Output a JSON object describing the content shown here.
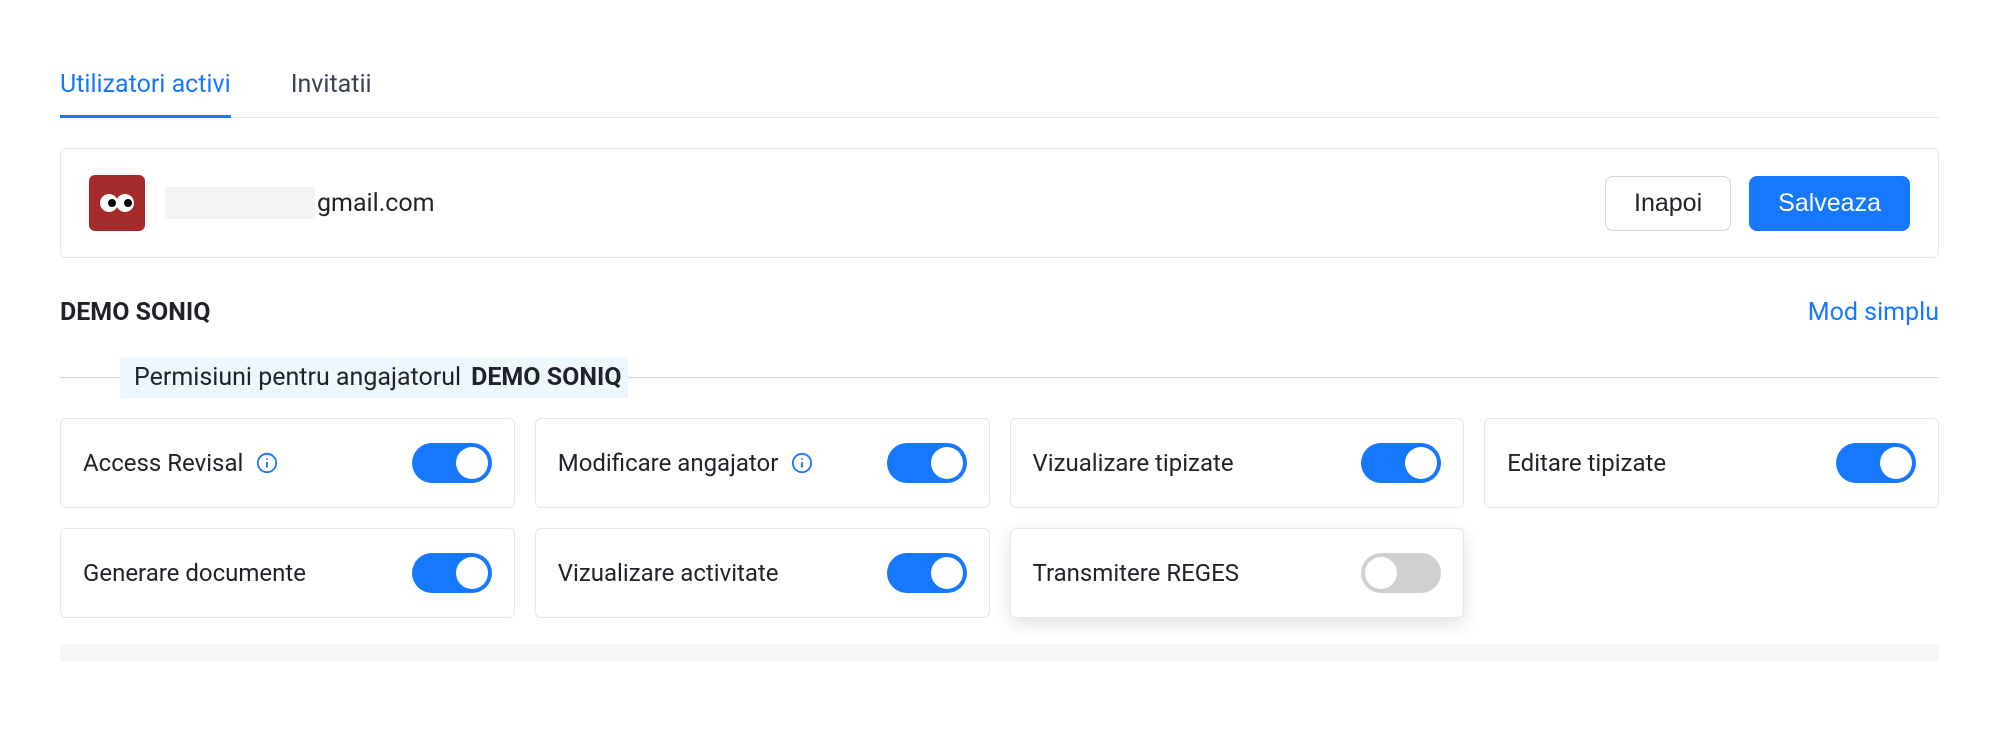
{
  "tabs": {
    "active_users": "Utilizatori activi",
    "invitations": "Invitatii"
  },
  "user": {
    "email_suffix": "gmail.com",
    "back_label": "Inapoi",
    "save_label": "Salveaza"
  },
  "section": {
    "title": "DEMO SONIQ",
    "mode_link": "Mod simplu",
    "legend_prefix": "Permisiuni pentru angajatorul",
    "legend_employer": "DEMO SONIQ"
  },
  "permissions": [
    {
      "label": "Access Revisal",
      "info": true,
      "on": true
    },
    {
      "label": "Modificare angajator",
      "info": true,
      "on": true
    },
    {
      "label": "Vizualizare tipizate",
      "info": false,
      "on": true
    },
    {
      "label": "Editare tipizate",
      "info": false,
      "on": true
    },
    {
      "label": "Generare documente",
      "info": false,
      "on": true
    },
    {
      "label": "Vizualizare activitate",
      "info": false,
      "on": true
    },
    {
      "label": "Transmitere REGES",
      "info": false,
      "on": false,
      "highlight": true
    }
  ]
}
